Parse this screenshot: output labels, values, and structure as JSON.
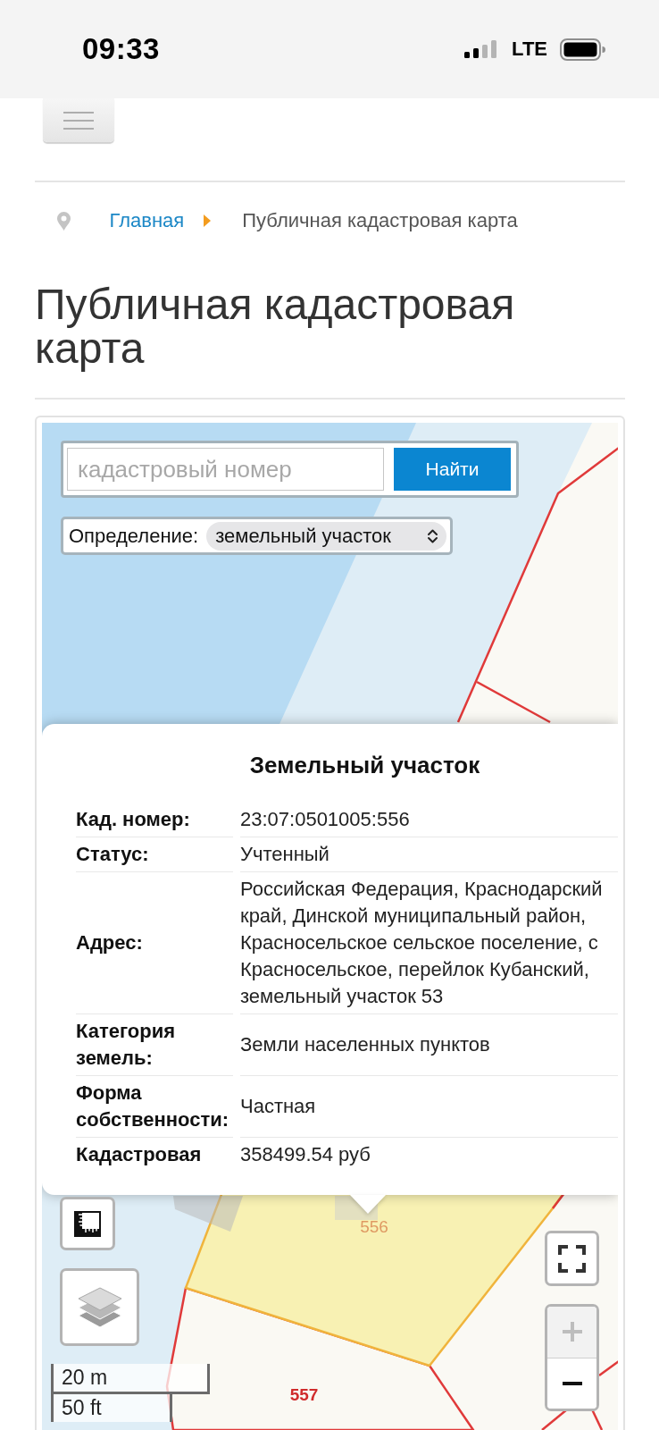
{
  "status_bar": {
    "time": "09:33",
    "network": "LTE"
  },
  "breadcrumb": [
    {
      "label": "Главная",
      "kind": "link"
    },
    {
      "label": "Публичная кадастровая карта",
      "kind": "current"
    }
  ],
  "page_title": "Публичная кадастровая карта",
  "map": {
    "search": {
      "placeholder": "кадастровый номер",
      "button": "Найти"
    },
    "identify": {
      "label": "Определение:",
      "value": "земельный участок"
    },
    "popup": {
      "title": "Земельный участок",
      "rows": [
        {
          "label": "Кад. номер:",
          "value": "23:07:0501005:556"
        },
        {
          "label": "Статус:",
          "value": "Учтенный"
        },
        {
          "label": "Адрес:",
          "value": "Российская Федерация, Краснодарский край, Динской муниципальный район, Красносельское сельское поселение, с Красносельское, перейлок Кубанский, земельный участок 53"
        },
        {
          "label": "Категория земель:",
          "value": "Земли населенных пунктов"
        },
        {
          "label": "Форма собственности:",
          "value": "Частная"
        },
        {
          "label": "Кадастровая",
          "value": "358499.54 руб"
        }
      ]
    },
    "parcels": [
      {
        "number": "556",
        "selected": true
      },
      {
        "number": "557",
        "selected": false
      }
    ],
    "zoom_controls": [
      {
        "kind": "zoom_in",
        "disabled": true
      },
      {
        "kind": "zoom_out",
        "disabled": false
      }
    ],
    "scale": [
      "20 m",
      "50 ft"
    ]
  }
}
